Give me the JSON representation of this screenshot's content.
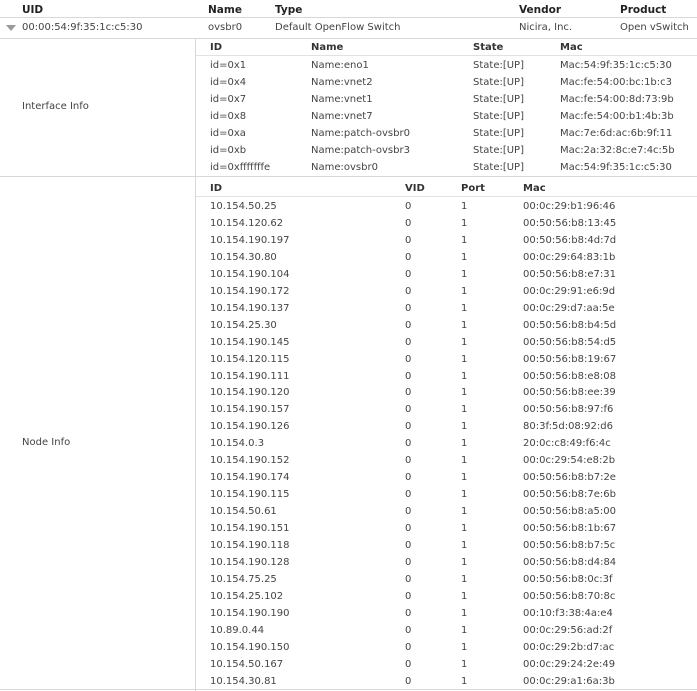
{
  "main_header": {
    "uid": "UID",
    "name": "Name",
    "type": "Type",
    "vendor": "Vendor",
    "product": "Product"
  },
  "switch_row": {
    "uid": "00:00:54:9f:35:1c:c5:30",
    "name": "ovsbr0",
    "type": "Default OpenFlow Switch",
    "vendor": "Nicira, Inc.",
    "product": "Open vSwitch"
  },
  "interface_info": {
    "label": "Interface Info",
    "headers": {
      "id": "ID",
      "name": "Name",
      "state": "State",
      "mac": "Mac"
    },
    "rows": [
      {
        "id": "id=0x1",
        "name": "Name:eno1",
        "state": "State:[UP]",
        "mac": "Mac:54:9f:35:1c:c5:30"
      },
      {
        "id": "id=0x4",
        "name": "Name:vnet2",
        "state": "State:[UP]",
        "mac": "Mac:fe:54:00:bc:1b:c3"
      },
      {
        "id": "id=0x7",
        "name": "Name:vnet1",
        "state": "State:[UP]",
        "mac": "Mac:fe:54:00:8d:73:9b"
      },
      {
        "id": "id=0x8",
        "name": "Name:vnet7",
        "state": "State:[UP]",
        "mac": "Mac:fe:54:00:b1:4b:3b"
      },
      {
        "id": "id=0xa",
        "name": "Name:patch-ovsbr0",
        "state": "State:[UP]",
        "mac": "Mac:7e:6d:ac:6b:9f:11"
      },
      {
        "id": "id=0xb",
        "name": "Name:patch-ovsbr3",
        "state": "State:[UP]",
        "mac": "Mac:2a:32:8c:e7:4c:5b"
      },
      {
        "id": "id=0xfffffffe",
        "name": "Name:ovsbr0",
        "state": "State:[UP]",
        "mac": "Mac:54:9f:35:1c:c5:30"
      }
    ]
  },
  "node_info": {
    "label": "Node Info",
    "headers": {
      "id": "ID",
      "vid": "VID",
      "port": "Port",
      "mac": "Mac"
    },
    "rows": [
      {
        "id": "10.154.50.25",
        "vid": "0",
        "port": "1",
        "mac": "00:0c:29:b1:96:46"
      },
      {
        "id": "10.154.120.62",
        "vid": "0",
        "port": "1",
        "mac": "00:50:56:b8:13:45"
      },
      {
        "id": "10.154.190.197",
        "vid": "0",
        "port": "1",
        "mac": "00:50:56:b8:4d:7d"
      },
      {
        "id": "10.154.30.80",
        "vid": "0",
        "port": "1",
        "mac": "00:0c:29:64:83:1b"
      },
      {
        "id": "10.154.190.104",
        "vid": "0",
        "port": "1",
        "mac": "00:50:56:b8:e7:31"
      },
      {
        "id": "10.154.190.172",
        "vid": "0",
        "port": "1",
        "mac": "00:0c:29:91:e6:9d"
      },
      {
        "id": "10.154.190.137",
        "vid": "0",
        "port": "1",
        "mac": "00:0c:29:d7:aa:5e"
      },
      {
        "id": "10.154.25.30",
        "vid": "0",
        "port": "1",
        "mac": "00:50:56:b8:b4:5d"
      },
      {
        "id": "10.154.190.145",
        "vid": "0",
        "port": "1",
        "mac": "00:50:56:b8:54:d5"
      },
      {
        "id": "10.154.120.115",
        "vid": "0",
        "port": "1",
        "mac": "00:50:56:b8:19:67"
      },
      {
        "id": "10.154.190.111",
        "vid": "0",
        "port": "1",
        "mac": "00:50:56:b8:e8:08"
      },
      {
        "id": "10.154.190.120",
        "vid": "0",
        "port": "1",
        "mac": "00:50:56:b8:ee:39"
      },
      {
        "id": "10.154.190.157",
        "vid": "0",
        "port": "1",
        "mac": "00:50:56:b8:97:f6"
      },
      {
        "id": "10.154.190.126",
        "vid": "0",
        "port": "1",
        "mac": "80:3f:5d:08:92:d6"
      },
      {
        "id": "10.154.0.3",
        "vid": "0",
        "port": "1",
        "mac": "20:0c:c8:49:f6:4c"
      },
      {
        "id": "10.154.190.152",
        "vid": "0",
        "port": "1",
        "mac": "00:0c:29:54:e8:2b"
      },
      {
        "id": "10.154.190.174",
        "vid": "0",
        "port": "1",
        "mac": "00:50:56:b8:b7:2e"
      },
      {
        "id": "10.154.190.115",
        "vid": "0",
        "port": "1",
        "mac": "00:50:56:b8:7e:6b"
      },
      {
        "id": "10.154.50.61",
        "vid": "0",
        "port": "1",
        "mac": "00:50:56:b8:a5:00"
      },
      {
        "id": "10.154.190.151",
        "vid": "0",
        "port": "1",
        "mac": "00:50:56:b8:1b:67"
      },
      {
        "id": "10.154.190.118",
        "vid": "0",
        "port": "1",
        "mac": "00:50:56:b8:b7:5c"
      },
      {
        "id": "10.154.190.128",
        "vid": "0",
        "port": "1",
        "mac": "00:50:56:b8:d4:84"
      },
      {
        "id": "10.154.75.25",
        "vid": "0",
        "port": "1",
        "mac": "00:50:56:b8:0c:3f"
      },
      {
        "id": "10.154.25.102",
        "vid": "0",
        "port": "1",
        "mac": "00:50:56:b8:70:8c"
      },
      {
        "id": "10.154.190.190",
        "vid": "0",
        "port": "1",
        "mac": "00:10:f3:38:4a:e4"
      },
      {
        "id": "10.89.0.44",
        "vid": "0",
        "port": "1",
        "mac": "00:0c:29:56:ad:2f"
      },
      {
        "id": "10.154.190.150",
        "vid": "0",
        "port": "1",
        "mac": "00:0c:29:2b:d7:ac"
      },
      {
        "id": "10.154.50.167",
        "vid": "0",
        "port": "1",
        "mac": "00:0c:29:24:2e:49"
      },
      {
        "id": "10.154.30.81",
        "vid": "0",
        "port": "1",
        "mac": "00:0c:29:a1:6a:3b"
      }
    ]
  }
}
